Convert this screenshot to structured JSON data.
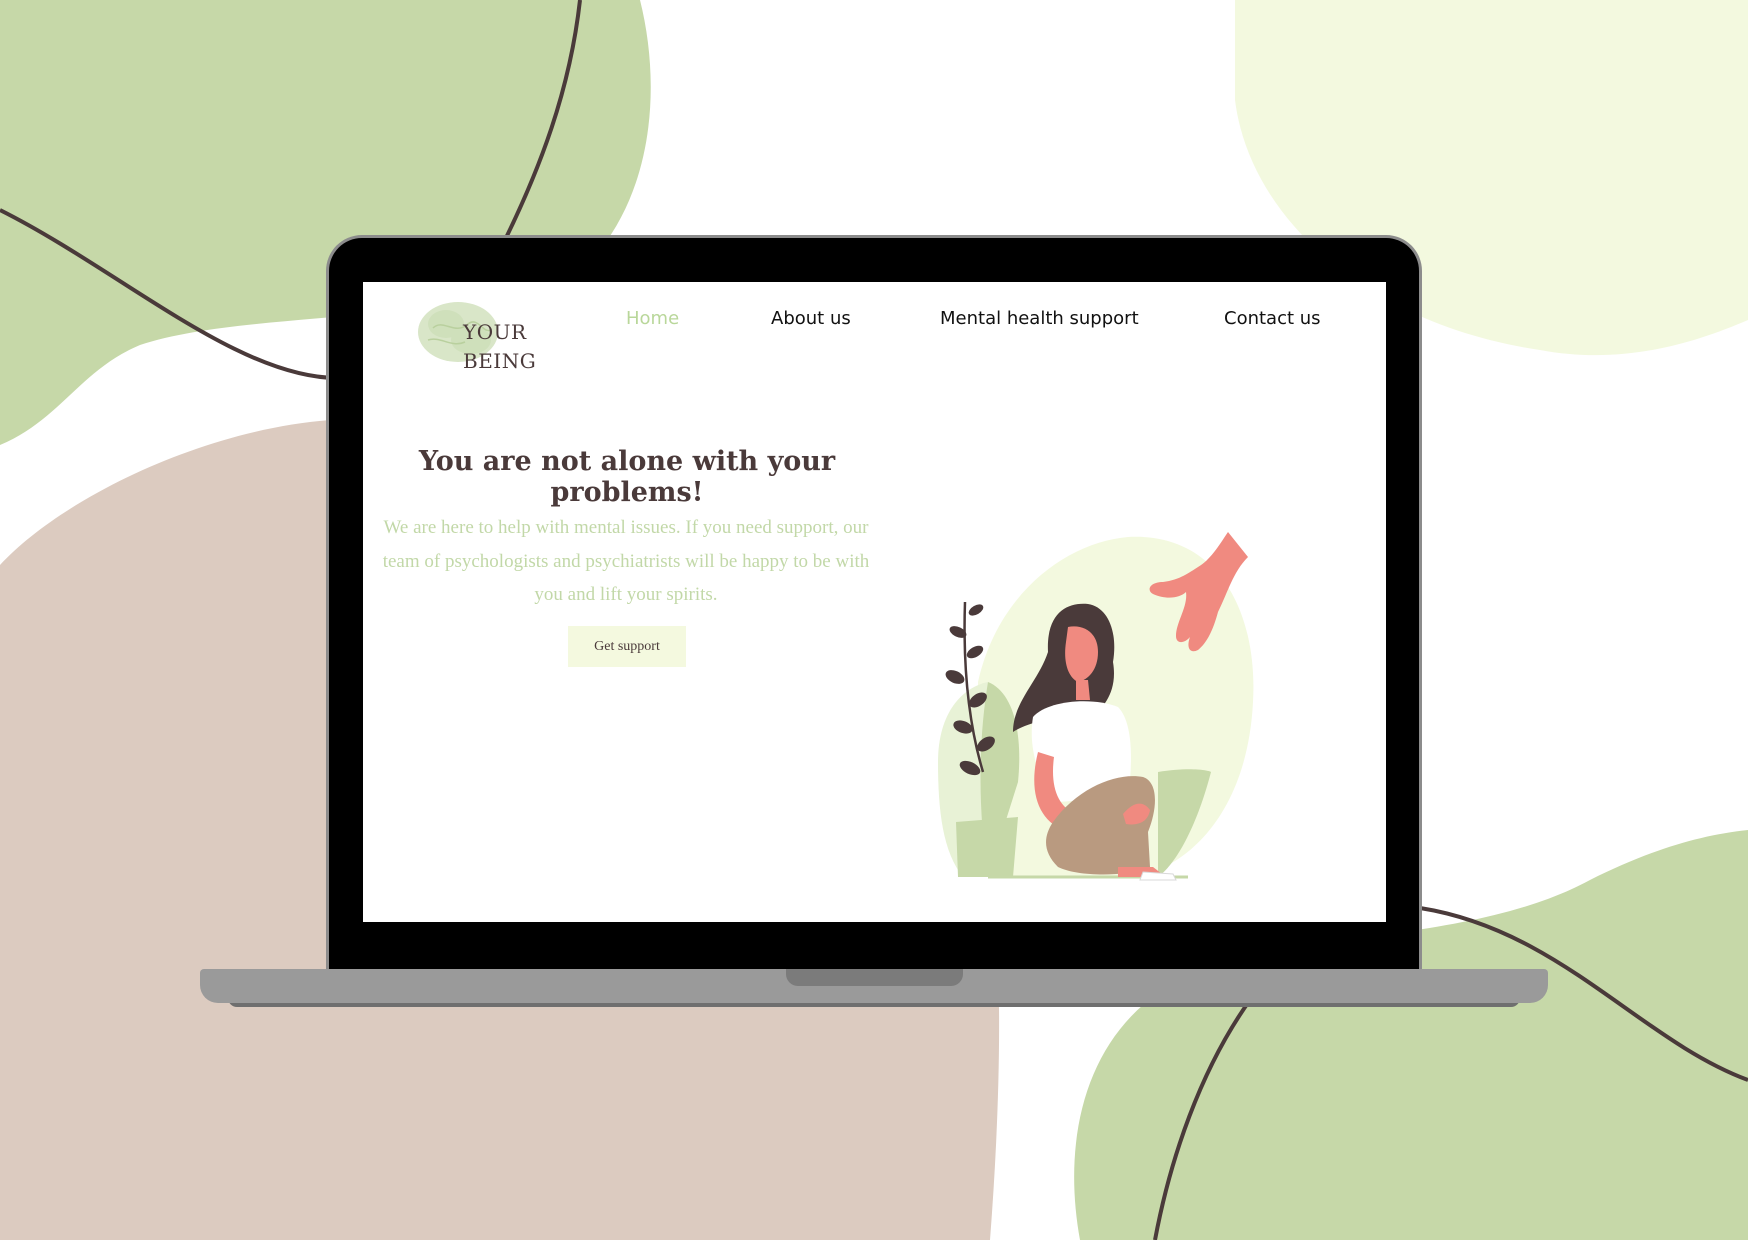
{
  "brand": {
    "line1": "YOUR",
    "line2": "BEING"
  },
  "nav": {
    "home": "Home",
    "about": "About us",
    "support": "Mental health support",
    "contact": "Contact us"
  },
  "hero": {
    "title": "You are not alone with your problems!",
    "lead": "We are here to help with mental issues. If you need support, our team of psychologists and psychiatrists will be happy to be with you and lift your spirits.",
    "cta": "Get support"
  },
  "colors": {
    "accent_green": "#b9d79a",
    "light_green": "#f4f9df",
    "beige": "#dccbc0",
    "dark_brown": "#4a3a3a",
    "pink": "#f08a80"
  },
  "icons": [
    "brain-logo-icon",
    "hand-icon",
    "woman-illustration",
    "plant-icon"
  ]
}
